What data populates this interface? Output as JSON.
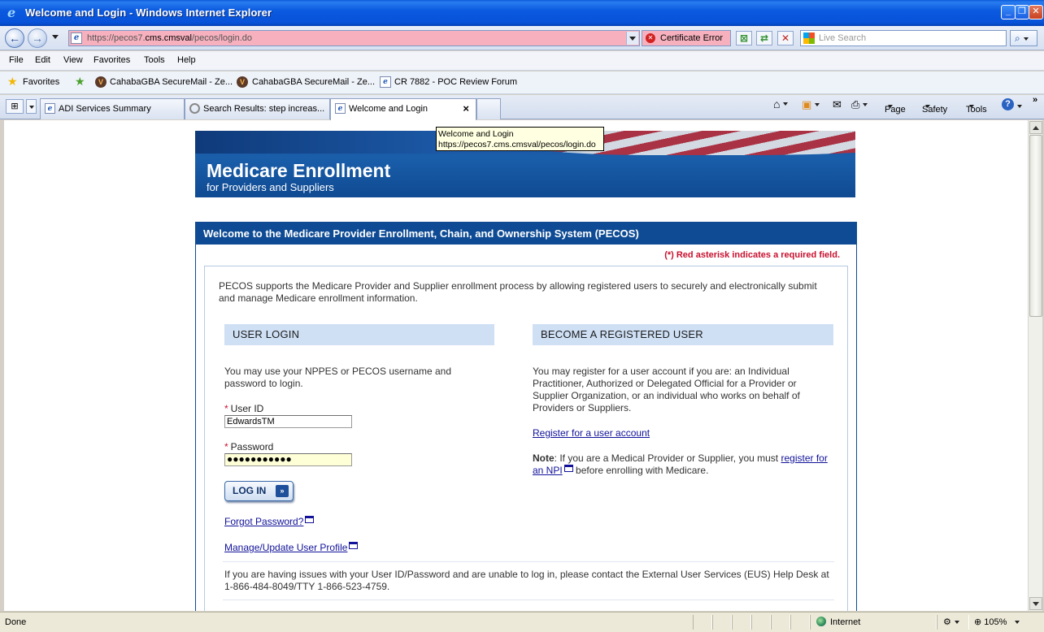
{
  "window": {
    "title": "Welcome and Login - Windows Internet Explorer",
    "min": "_",
    "restore": "❐",
    "close": "✕"
  },
  "address": {
    "url_prefix": "https://pecos7.",
    "url_host": "cms.cmsval",
    "url_rest": "/pecos/login.do",
    "cert_error": "Certificate Error",
    "search_placeholder": "Live Search"
  },
  "menu": [
    "File",
    "Edit",
    "View",
    "Favorites",
    "Tools",
    "Help"
  ],
  "favorites": {
    "label": "Favorites",
    "items": [
      "CahabaGBA SecureMail - Ze...",
      "CahabaGBA SecureMail - Ze...",
      "CR 7882 - POC Review Forum"
    ]
  },
  "tabs": [
    {
      "label": "ADI Services Summary",
      "active": false
    },
    {
      "label": "Search Results: step increas...",
      "active": false
    },
    {
      "label": "Welcome and Login",
      "active": true
    }
  ],
  "commandbar": {
    "page": "Page",
    "safety": "Safety",
    "tools": "Tools"
  },
  "tooltip": {
    "line1": "Welcome and Login",
    "line2": "https://pecos7.cms.cmsval/pecos/login.do"
  },
  "banner": {
    "title": "Medicare Enrollment",
    "subtitle": "for Providers and Suppliers"
  },
  "panel": {
    "header": "Welcome to the Medicare Provider Enrollment, Chain, and Ownership System (PECOS)",
    "required_note": "(*) Red asterisk indicates a required field.",
    "intro": "PECOS supports the Medicare Provider and Supplier enrollment process by allowing registered users to securely and electronically submit and manage Medicare enrollment information."
  },
  "login": {
    "heading": "USER LOGIN",
    "description": "You may use your NPPES or PECOS username and password to login.",
    "required_mark": "*",
    "userid_label": "User ID",
    "userid_value": "EdwardsTM",
    "password_label": "Password",
    "password_value": "●●●●●●●●●●●",
    "button": "LOG IN",
    "forgot": "Forgot Password?",
    "manage": "Manage/Update User Profile"
  },
  "register": {
    "heading": "BECOME A REGISTERED USER",
    "description": "You may register for a user account if you are: an Individual Practitioner, Authorized or Delegated Official for a Provider or Supplier Organization, or an individual who works on behalf of Providers or Suppliers.",
    "link": "Register for a user account",
    "note_label": "Note",
    "note_text": ": If you are a Medical Provider or Supplier, you must ",
    "note_link": "register for an NPI",
    "note_after": " before enrolling with Medicare."
  },
  "help": {
    "text": "If you are having issues with your User ID/Password and are unable to log in, please contact the External User Services (EUS) Help Desk at 1-866-484-8049/TTY 1-866-523-4759."
  },
  "status": {
    "left": "Done",
    "zone": "Internet",
    "zoom": "105%"
  }
}
